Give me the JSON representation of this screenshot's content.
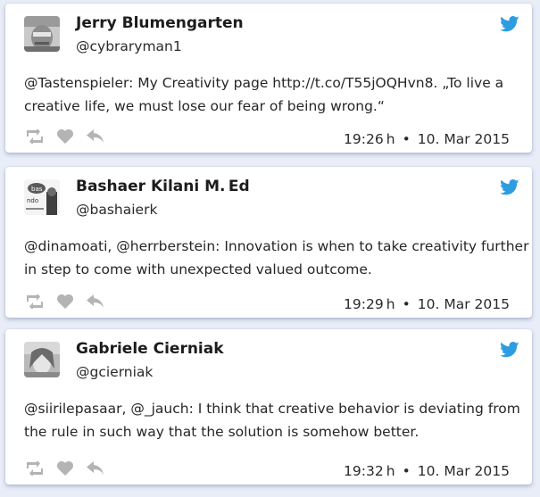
{
  "colors": {
    "page_background": "#e9edf7",
    "card_background": "#ffffff",
    "twitter_blue": "#2d9de0",
    "action_gray": "#b4b4b4",
    "text": "#262626"
  },
  "icons": {
    "brand": "twitter-bird-icon",
    "retweet": "retweet-icon",
    "favorite": "heart-icon",
    "reply": "reply-icon"
  },
  "tweets": [
    {
      "name": "Jerry Blumengarten",
      "handle": "@cybraryman1",
      "text_lines": [
        "@Tastenspieler: My Creativity page http://t.co/T55jOQHvn8. „To live a",
        "creative life, we must lose our fear of being wrong.“"
      ],
      "time": "19:26 h",
      "separator": "•",
      "date": "10. Mar 2015"
    },
    {
      "name": "Bashaer Kilani M. Ed",
      "handle": "@bashaierk",
      "avatar_text": [
        "bas",
        "ndo"
      ],
      "text_lines": [
        "@dinamoati, @herrberstein: Innovation is when to take creativity further",
        "in step to come with unexpected valued outcome."
      ],
      "time": "19:29 h",
      "separator": "•",
      "date": "10. Mar 2015"
    },
    {
      "name": "Gabriele Cierniak",
      "handle": "@gcierniak",
      "text_lines": [
        "@siirilepasaar, @_jauch: I think that creative behavior is deviating from",
        "the rule in such way that the solution is somehow better."
      ],
      "time": "19:32 h",
      "separator": "•",
      "date": "10. Mar 2015"
    }
  ]
}
